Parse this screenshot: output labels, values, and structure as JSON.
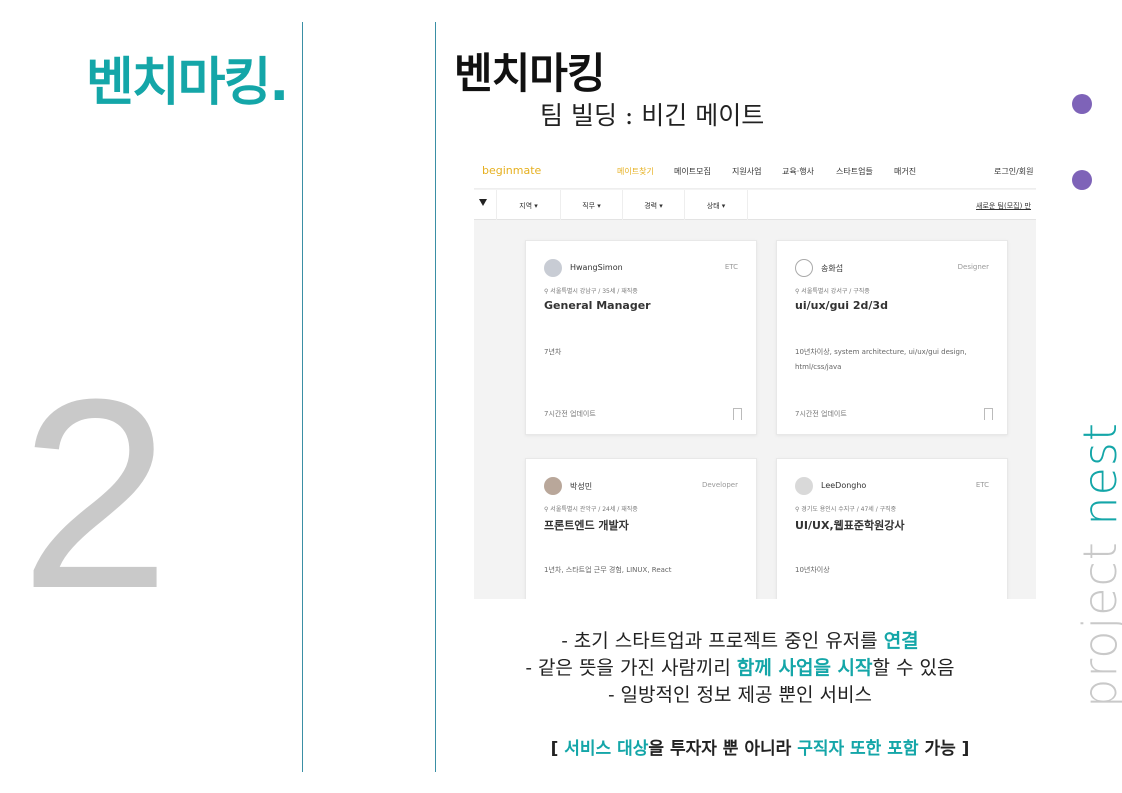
{
  "side": {
    "title": "벤치마킹.",
    "number": "2"
  },
  "main": {
    "title": "벤치마킹",
    "subtitle": "팀 빌딩 : 비긴 메이트"
  },
  "brand": {
    "part1": "project ",
    "part2": "nest"
  },
  "colors": {
    "accent": "#14a6a8",
    "dot": "#7e63b8",
    "logo": "#e6b020",
    "number": "#c9c9c9"
  },
  "screenshot": {
    "logo": "beginmate",
    "nav": [
      "메이트찾기",
      "메이트모집",
      "지원사업",
      "교육·행사",
      "스타트업들",
      "매거진"
    ],
    "login": "로그인/회원",
    "filters": [
      "지역 ▾",
      "직무 ▾",
      "경력 ▾",
      "상태 ▾"
    ],
    "new_post": "새로운 팀(모집) 만",
    "cards": [
      {
        "name": "HwangSimon",
        "tag": "ETC",
        "meta": "⚲ 서울특별시 강남구 / 35세 / 재직중",
        "title": "General Manager",
        "desc": "7년차",
        "time": "7시간전 업데이트"
      },
      {
        "name": "송화섭",
        "tag": "Designer",
        "meta": "⚲ 서울특별시 강서구 / 구직중",
        "title": "ui/ux/gui 2d/3d",
        "desc": "10년차이상, system architecture, ui/ux/gui design, html/css/java",
        "time": "7시간전 업데이트"
      },
      {
        "name": "박성민",
        "tag": "Developer",
        "meta": "⚲ 서울특별시 관악구 / 24세 / 재직중",
        "title": "프론트엔드 개발자",
        "desc": "1년차, 스타트업 근무 경험, LINUX, React",
        "time": ""
      },
      {
        "name": "LeeDongho",
        "tag": "ETC",
        "meta": "⚲ 경기도 용인시 수지구 / 47세 / 구직중",
        "title": "UI/UX,웹표준학원강사",
        "desc": "10년차이상",
        "time": ""
      }
    ]
  },
  "bullets": {
    "b1_a": "-   초기 스타트업과 프로젝트 중인 유저를 ",
    "b1_hl": "연결",
    "b2_a": "-   같은 뜻을 가진 사람끼리 ",
    "b2_hl": "함께 사업을 시작",
    "b2_b": "할 수 있음",
    "b3": "-   일방적인 정보 제공 뿐인 서비스"
  },
  "note": {
    "open": "[ ",
    "hl1": "서비스 대상",
    "mid": "을 투자자 뿐 아니라 ",
    "hl2": "구직자 또한 포함",
    "end": " 가능 ]"
  }
}
